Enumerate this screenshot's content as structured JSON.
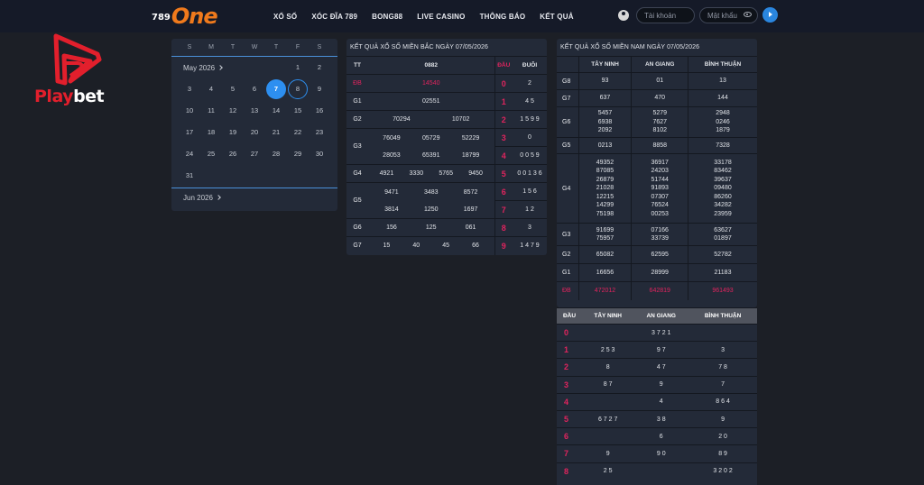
{
  "header": {
    "logo_num": "789",
    "logo_word": "One",
    "nav": [
      "XỔ SỐ",
      "XÓC ĐĨA 789",
      "BONG88",
      "LIVE CASINO",
      "THÔNG BÁO",
      "KẾT QUẢ"
    ],
    "username_placeholder": "Tài khoản",
    "password_placeholder": "Mật khẩu"
  },
  "playbet": {
    "part1": "Play",
    "part2": "bet"
  },
  "calendar": {
    "weekdays": [
      "S",
      "M",
      "T",
      "W",
      "T",
      "F",
      "S"
    ],
    "month_label": "May 2026",
    "next_label": "Jun 2026",
    "days": [
      "1",
      "2",
      "3",
      "4",
      "5",
      "6",
      "7",
      "8",
      "9",
      "10",
      "11",
      "12",
      "13",
      "14",
      "15",
      "16",
      "17",
      "18",
      "19",
      "20",
      "21",
      "22",
      "23",
      "24",
      "25",
      "26",
      "27",
      "28",
      "29",
      "30",
      "31"
    ],
    "today": "7",
    "selected": "8"
  },
  "north": {
    "title": "KẾT QUẢ XỔ SỐ MIỀN BẮC NGÀY 07/05/2026",
    "col_tt": "TT",
    "code": "0882",
    "col_dau": "ĐẦU",
    "col_duoi": "ĐUÔI",
    "rows": [
      {
        "label": "ĐB",
        "vals": [
          "14540"
        ],
        "dau": "0",
        "duoi": "2"
      },
      {
        "label": "G1",
        "vals": [
          "02551"
        ],
        "dau": "1",
        "duoi": "4 5"
      },
      {
        "label": "G2",
        "vals": [
          "70294",
          "10702"
        ],
        "dau": "2",
        "duoi": "1 5 9 9"
      },
      {
        "label": "G3",
        "vals": [
          "76049",
          "05729",
          "52229",
          "28053",
          "65391",
          "18799"
        ],
        "dau": "3",
        "duoi": "0"
      },
      {
        "label": "G4",
        "vals": [
          "4921",
          "3330",
          "5765",
          "9450"
        ],
        "dau": "4",
        "duoi": "0 0 5 9"
      },
      {
        "label": "G5",
        "vals": [
          "9471",
          "3483",
          "8572",
          "3814",
          "1250",
          "1697"
        ],
        "dau": "5",
        "duoi": "0 0 1 3 6"
      },
      {
        "label": "G6",
        "vals": [
          "156",
          "125",
          "061"
        ],
        "dau": "6",
        "duoi": "1 5 6"
      },
      {
        "label": "G7",
        "vals": [
          "15",
          "40",
          "45",
          "66"
        ],
        "dau": "7",
        "duoi": "1 2"
      },
      {
        "extra": true,
        "dau": "8",
        "duoi": "3"
      },
      {
        "extra": true,
        "dau": "9",
        "duoi": "1 4 7 9"
      }
    ]
  },
  "south": {
    "title": "KẾT QUẢ XỔ SỐ MIỀN NAM NGÀY 07/05/2026",
    "provinces": [
      "TÂY NINH",
      "AN GIANG",
      "BÌNH THUẬN"
    ],
    "rows": [
      {
        "label": "G8",
        "vals": [
          [
            "93"
          ],
          [
            "01"
          ],
          [
            "13"
          ]
        ]
      },
      {
        "label": "G7",
        "vals": [
          [
            "637"
          ],
          [
            "470"
          ],
          [
            "144"
          ]
        ]
      },
      {
        "label": "G6",
        "vals": [
          [
            "5457",
            "6938",
            "2092"
          ],
          [
            "5279",
            "7627",
            "8102"
          ],
          [
            "2948",
            "0246",
            "1879"
          ]
        ]
      },
      {
        "label": "G5",
        "vals": [
          [
            "0213"
          ],
          [
            "8858"
          ],
          [
            "7328"
          ]
        ]
      },
      {
        "label": "G4",
        "vals": [
          [
            "49352",
            "87085",
            "26879",
            "21028",
            "12215",
            "14299",
            "75198"
          ],
          [
            "36917",
            "24203",
            "51744",
            "91893",
            "07307",
            "76524",
            "00253"
          ],
          [
            "33178",
            "83462",
            "39637",
            "09480",
            "86260",
            "34282",
            "23959"
          ]
        ]
      },
      {
        "label": "G3",
        "vals": [
          [
            "91699",
            "75957"
          ],
          [
            "07166",
            "33739"
          ],
          [
            "63627",
            "01897"
          ]
        ]
      },
      {
        "label": "G2",
        "vals": [
          [
            "65082"
          ],
          [
            "62595"
          ],
          [
            "52782"
          ]
        ]
      },
      {
        "label": "G1",
        "vals": [
          [
            "16656"
          ],
          [
            "28999"
          ],
          [
            "21183"
          ]
        ]
      },
      {
        "label": "ĐB",
        "vals": [
          [
            "472012"
          ],
          [
            "642819"
          ],
          [
            "961493"
          ]
        ],
        "red": true
      }
    ]
  },
  "dau_table": {
    "col_dau": "ĐẦU",
    "provinces": [
      "TÂY NINH",
      "AN GIANG",
      "BÌNH THUẬN"
    ],
    "rows": [
      {
        "dau": "0",
        "vals": [
          "",
          "3 7 2 1",
          ""
        ]
      },
      {
        "dau": "1",
        "vals": [
          "2 5 3",
          "9 7",
          "3"
        ]
      },
      {
        "dau": "2",
        "vals": [
          "8",
          "4 7",
          "7 8"
        ]
      },
      {
        "dau": "3",
        "vals": [
          "8 7",
          "9",
          "7"
        ]
      },
      {
        "dau": "4",
        "vals": [
          "",
          "4",
          "8 6 4"
        ]
      },
      {
        "dau": "5",
        "vals": [
          "6 7 2 7",
          "3 8",
          "9"
        ]
      },
      {
        "dau": "6",
        "vals": [
          "",
          "6",
          "2 0"
        ]
      },
      {
        "dau": "7",
        "vals": [
          "9",
          "9 0",
          "8 9"
        ]
      },
      {
        "dau": "8",
        "vals": [
          "2 5",
          "",
          "3 2 0 2"
        ]
      }
    ]
  }
}
